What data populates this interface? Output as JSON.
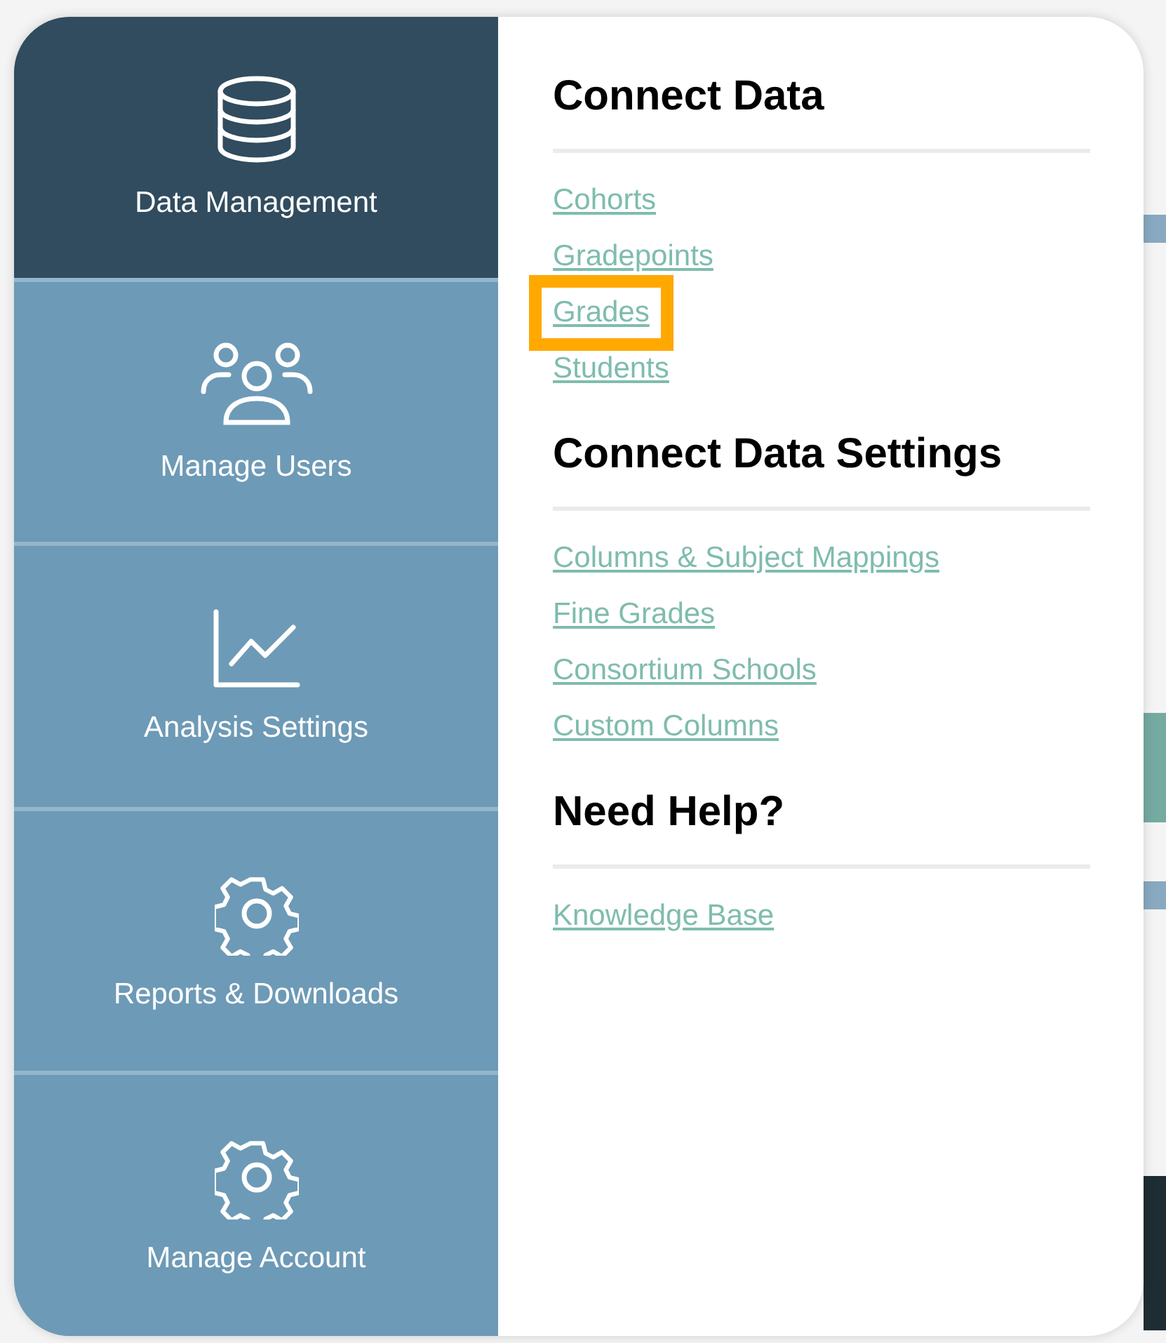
{
  "sidebar": {
    "items": [
      {
        "label": "Data Management",
        "kind": "database",
        "selected": true
      },
      {
        "label": "Manage Users",
        "kind": "users",
        "selected": false
      },
      {
        "label": "Analysis Settings",
        "kind": "chart",
        "selected": false
      },
      {
        "label": "Reports & Downloads",
        "kind": "gear",
        "selected": false
      },
      {
        "label": "Manage Account",
        "kind": "gear",
        "selected": false
      }
    ]
  },
  "sections": [
    {
      "heading": "Connect Data",
      "links": [
        {
          "label": "Cohorts",
          "highlighted": false
        },
        {
          "label": "Gradepoints",
          "highlighted": false
        },
        {
          "label": "Grades",
          "highlighted": true
        },
        {
          "label": "Students",
          "highlighted": false
        }
      ]
    },
    {
      "heading": "Connect Data Settings",
      "links": [
        {
          "label": "Columns & Subject Mappings",
          "highlighted": false
        },
        {
          "label": "Fine Grades",
          "highlighted": false
        },
        {
          "label": "Consortium Schools",
          "highlighted": false
        },
        {
          "label": "Custom Columns",
          "highlighted": false
        }
      ]
    },
    {
      "heading": "Need Help?",
      "links": [
        {
          "label": "Knowledge Base",
          "highlighted": false
        }
      ]
    }
  ]
}
